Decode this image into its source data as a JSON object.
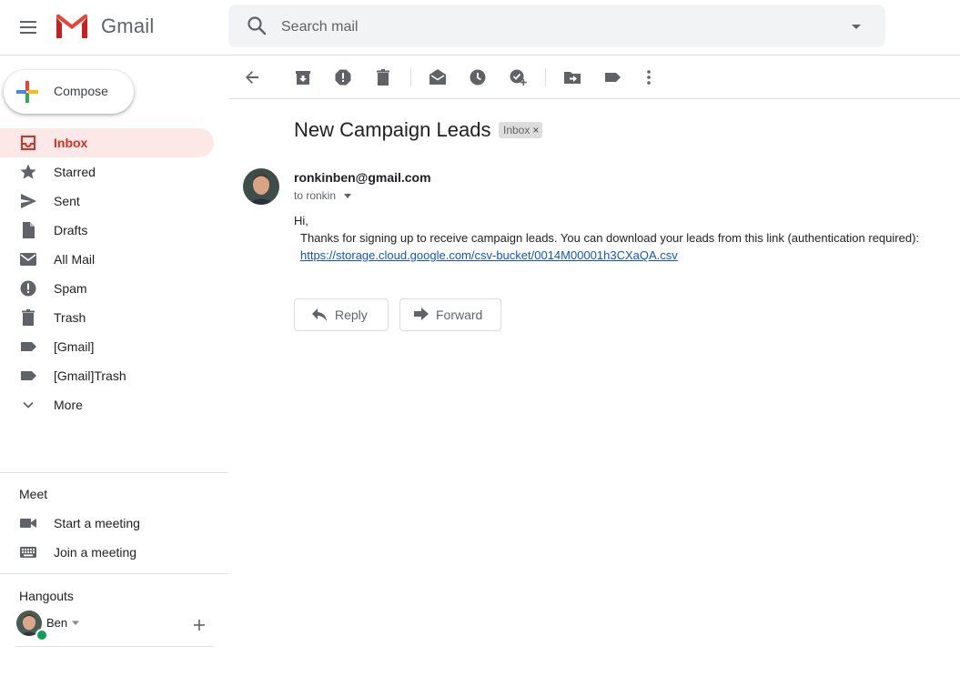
{
  "header": {
    "brand": "Gmail",
    "search_placeholder": "Search mail"
  },
  "compose_label": "Compose",
  "sidebar": {
    "items": [
      {
        "label": "Inbox",
        "icon": "inbox-icon",
        "active": true
      },
      {
        "label": "Starred",
        "icon": "star-icon"
      },
      {
        "label": "Sent",
        "icon": "send-icon"
      },
      {
        "label": "Drafts",
        "icon": "draft-icon"
      },
      {
        "label": "All Mail",
        "icon": "mail-icon"
      },
      {
        "label": "Spam",
        "icon": "spam-icon"
      },
      {
        "label": "Trash",
        "icon": "trash-icon"
      },
      {
        "label": "[Gmail]",
        "icon": "label-icon"
      },
      {
        "label": "[Gmail]Trash",
        "icon": "label-icon"
      },
      {
        "label": "More",
        "icon": "chevron-down-icon"
      }
    ]
  },
  "meet": {
    "title": "Meet",
    "start_label": "Start a meeting",
    "join_label": "Join a meeting"
  },
  "hangouts": {
    "title": "Hangouts",
    "user_name": "Ben",
    "status_color": "#0f9d58"
  },
  "message": {
    "subject": "New Campaign Leads",
    "label_badge": "Inbox",
    "label_remove": "×",
    "sender_email": "ronkinben@gmail.com",
    "recipient_text": "to ronkin",
    "greeting": "Hi,",
    "body": "Thanks for signing up to receive campaign leads. You can download your leads from this link (authentication required):",
    "link": "https://storage.cloud.google.com/csv-bucket/0014M00001h3CXaQA.csv"
  },
  "actions": {
    "reply": "Reply",
    "forward": "Forward"
  },
  "colors": {
    "accent_red": "#d93025",
    "active_bg": "#fce8e6",
    "link_blue": "#1155cc",
    "icon_gray": "#5f6368"
  }
}
